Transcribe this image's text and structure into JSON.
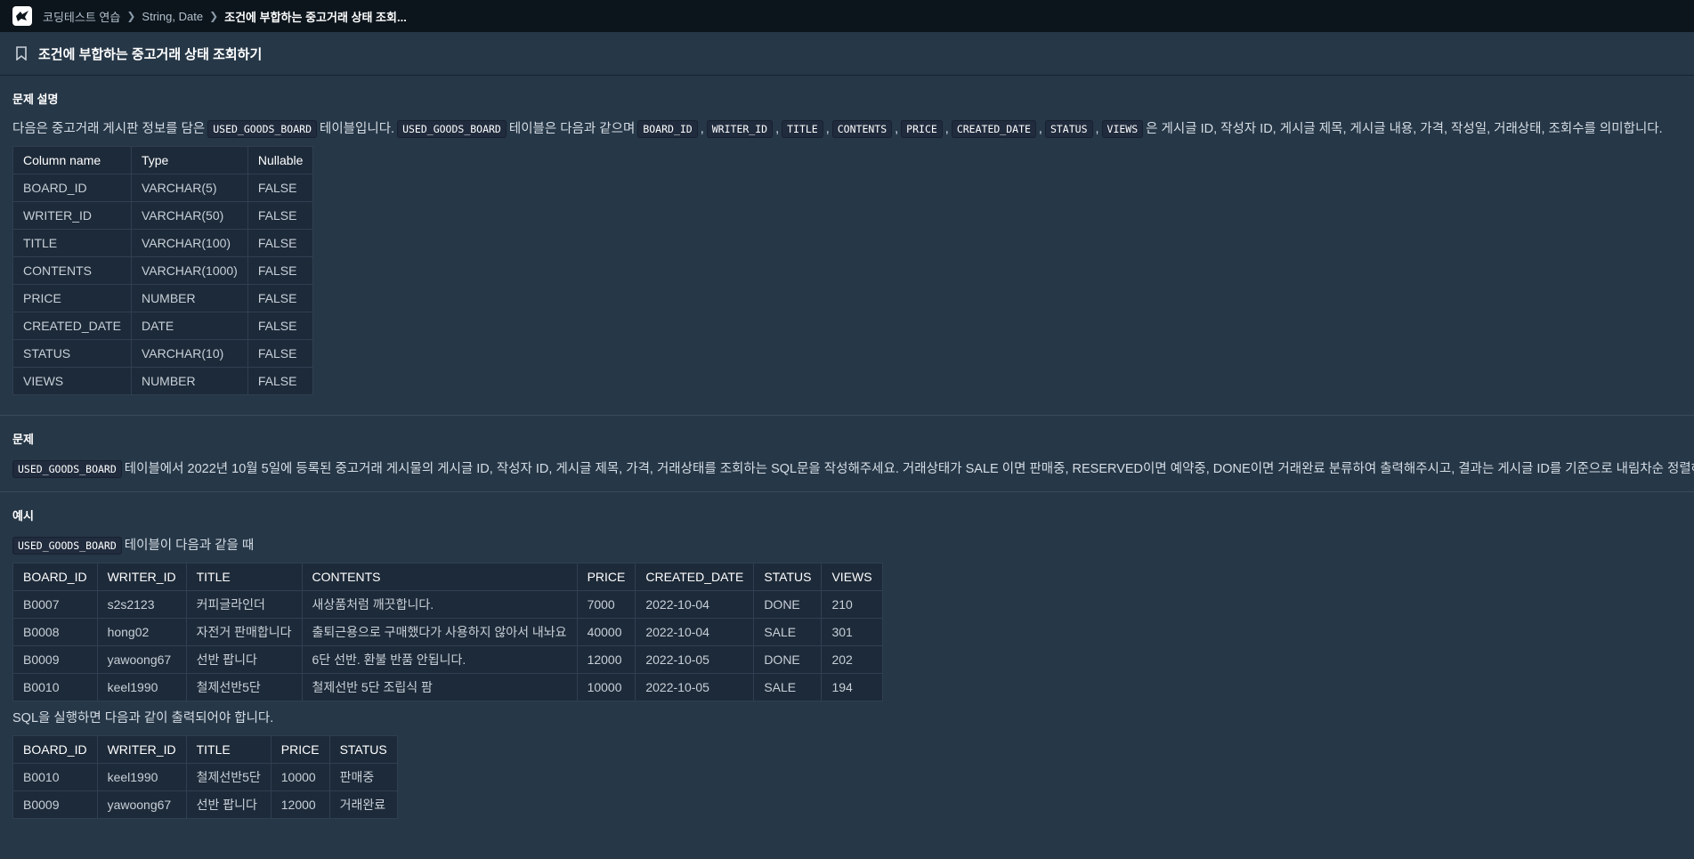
{
  "breadcrumb": {
    "items": [
      "코딩테스트 연습",
      "String, Date",
      "조건에 부합하는 중고거래 상태 조회..."
    ]
  },
  "page_title": "조건에 부합하는 중고거래 상태 조회하기",
  "description": {
    "heading": "문제 설명",
    "intro_before": "다음은 중고거래 게시판 정보를 담은",
    "table_name": "USED_GOODS_BOARD",
    "intro_mid": "테이블입니다.",
    "intro_mid2": "테이블은 다음과 같으며",
    "columns_inline": [
      "BOARD_ID",
      "WRITER_ID",
      "TITLE",
      "CONTENTS",
      "PRICE",
      "CREATED_DATE",
      "STATUS",
      "VIEWS"
    ],
    "intro_after": "은 게시글 ID, 작성자 ID, 게시글 제목, 게시글 내용, 가격, 작성일, 거래상태, 조회수를 의미합니다.",
    "schema": {
      "headers": [
        "Column name",
        "Type",
        "Nullable"
      ],
      "rows": [
        [
          "BOARD_ID",
          "VARCHAR(5)",
          "FALSE"
        ],
        [
          "WRITER_ID",
          "VARCHAR(50)",
          "FALSE"
        ],
        [
          "TITLE",
          "VARCHAR(100)",
          "FALSE"
        ],
        [
          "CONTENTS",
          "VARCHAR(1000)",
          "FALSE"
        ],
        [
          "PRICE",
          "NUMBER",
          "FALSE"
        ],
        [
          "CREATED_DATE",
          "DATE",
          "FALSE"
        ],
        [
          "STATUS",
          "VARCHAR(10)",
          "FALSE"
        ],
        [
          "VIEWS",
          "NUMBER",
          "FALSE"
        ]
      ]
    }
  },
  "problem": {
    "heading": "문제",
    "table_name": "USED_GOODS_BOARD",
    "text": "테이블에서 2022년 10월 5일에 등록된 중고거래 게시물의 게시글 ID, 작성자 ID, 게시글 제목, 가격, 거래상태를 조회하는 SQL문을 작성해주세요. 거래상태가 SALE 이면 판매중, RESERVED이면 예약중, DONE이면 거래완료 분류하여 출력해주시고, 결과는 게시글 ID를 기준으로 내림차순 정렬해주세요."
  },
  "example": {
    "heading": "예시",
    "table_name": "USED_GOODS_BOARD",
    "intro": "테이블이 다음과 같을 때",
    "input": {
      "headers": [
        "BOARD_ID",
        "WRITER_ID",
        "TITLE",
        "CONTENTS",
        "PRICE",
        "CREATED_DATE",
        "STATUS",
        "VIEWS"
      ],
      "rows": [
        [
          "B0007",
          "s2s2123",
          "커피글라인더",
          "새상품처럼 깨끗합니다.",
          "7000",
          "2022-10-04",
          "DONE",
          "210"
        ],
        [
          "B0008",
          "hong02",
          "자전거 판매합니다",
          "출퇴근용으로 구매했다가 사용하지 않아서 내놔요",
          "40000",
          "2022-10-04",
          "SALE",
          "301"
        ],
        [
          "B0009",
          "yawoong67",
          "선반 팝니다",
          "6단 선반. 환불 반품 안됩니다.",
          "12000",
          "2022-10-05",
          "DONE",
          "202"
        ],
        [
          "B0010",
          "keel1990",
          "철제선반5단",
          "철제선반 5단 조립식 팜",
          "10000",
          "2022-10-05",
          "SALE",
          "194"
        ]
      ]
    },
    "output_intro": "SQL을 실행하면 다음과 같이 출력되어야 합니다.",
    "output": {
      "headers": [
        "BOARD_ID",
        "WRITER_ID",
        "TITLE",
        "PRICE",
        "STATUS"
      ],
      "rows": [
        [
          "B0010",
          "keel1990",
          "철제선반5단",
          "10000",
          "판매중"
        ],
        [
          "B0009",
          "yawoong67",
          "선반 팝니다",
          "12000",
          "거래완료"
        ]
      ]
    }
  }
}
